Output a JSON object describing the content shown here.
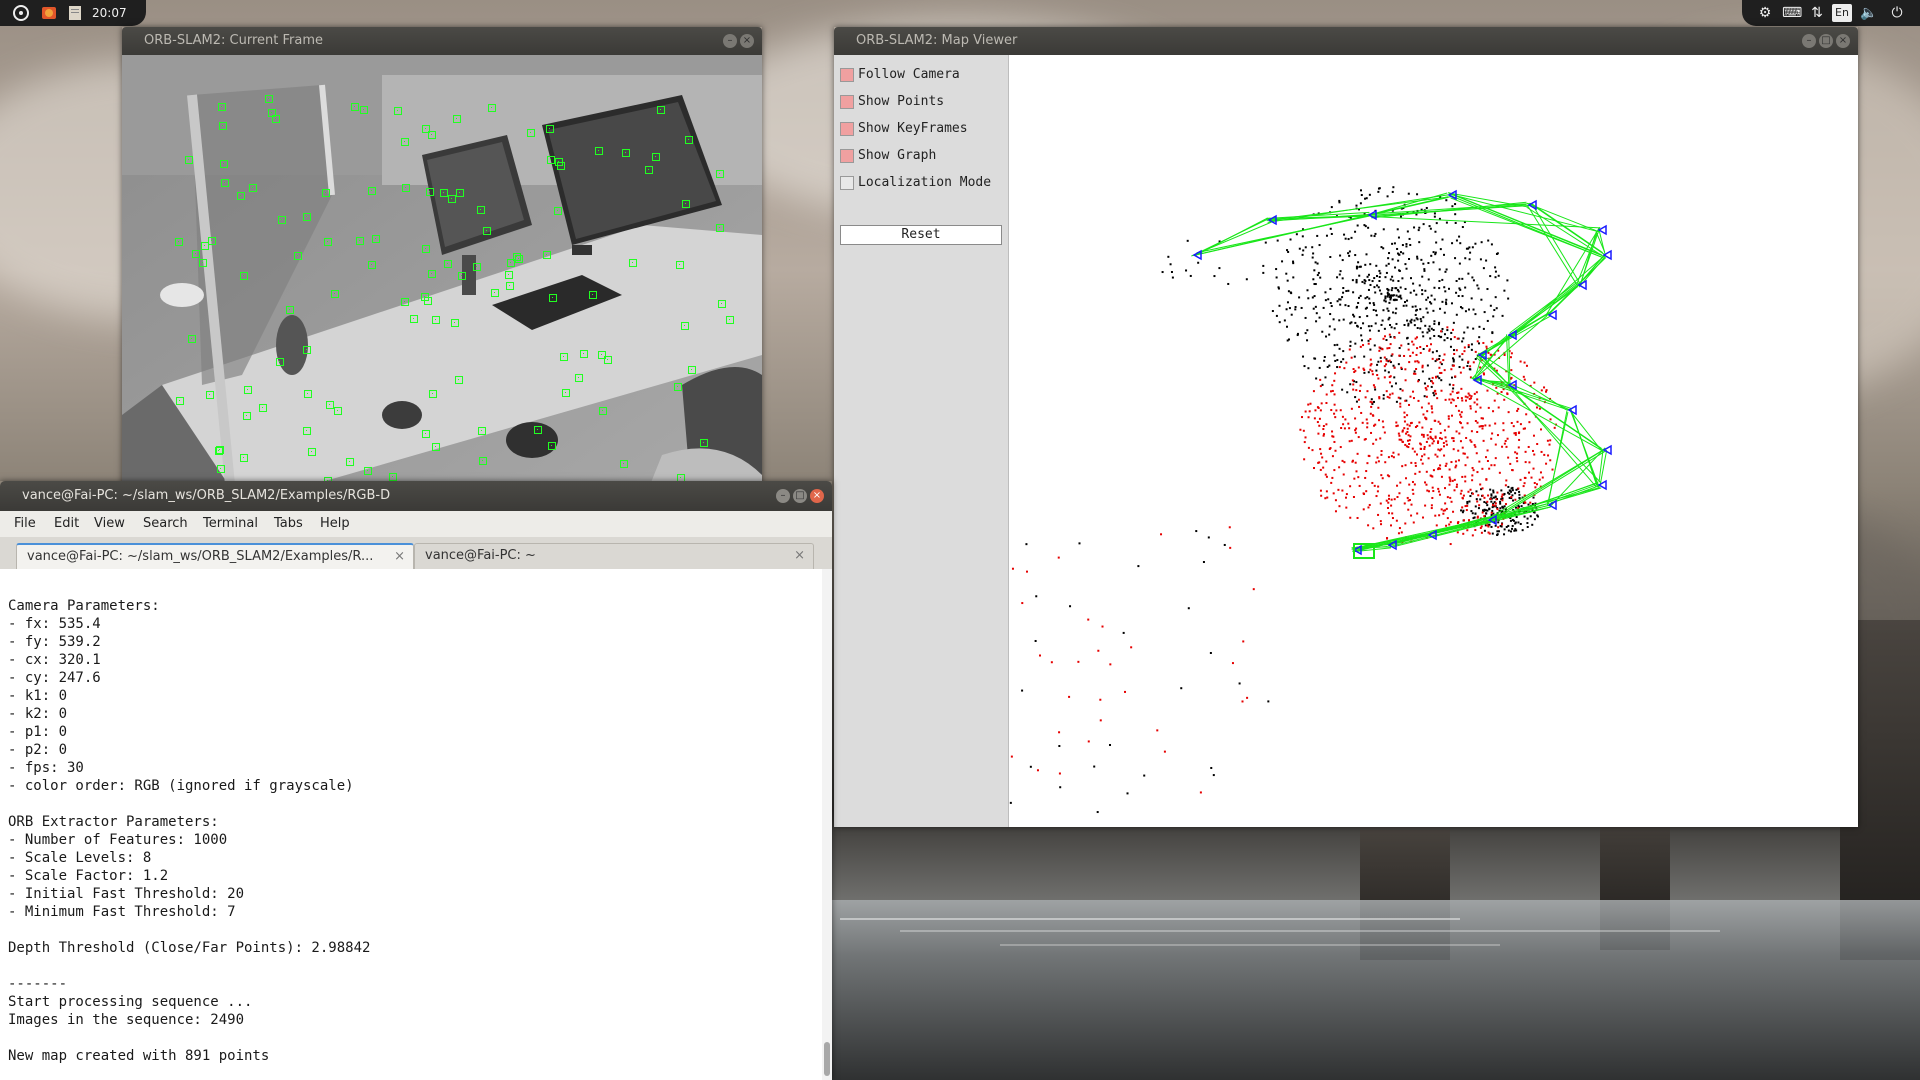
{
  "panel": {
    "clock": "20:07",
    "left_icons": [
      "ubuntu-logo-icon",
      "firefox-icon",
      "files-icon"
    ],
    "right_icons": [
      "settings-icon",
      "keyboard-icon",
      "network-icon",
      "language-icon",
      "volume-icon",
      "power-icon"
    ],
    "language": "En"
  },
  "current_frame": {
    "title": "ORB-SLAM2: Current Frame"
  },
  "map_viewer": {
    "title": "ORB-SLAM2: Map Viewer",
    "options": [
      {
        "label": "Follow Camera",
        "checked": true
      },
      {
        "label": "Show Points",
        "checked": true
      },
      {
        "label": "Show KeyFrames",
        "checked": true
      },
      {
        "label": "Show Graph",
        "checked": true
      },
      {
        "label": "Localization Mode",
        "checked": false
      }
    ],
    "reset_label": "Reset",
    "colors": {
      "keyframe": "#1a1aff",
      "graph": "#19e619",
      "map_point": "#e60000",
      "old_point": "#000000"
    }
  },
  "terminal": {
    "title": "vance@Fai-PC: ~/slam_ws/ORB_SLAM2/Examples/RGB-D",
    "menu": [
      "File",
      "Edit",
      "View",
      "Search",
      "Terminal",
      "Tabs",
      "Help"
    ],
    "tabs": [
      {
        "label": "vance@Fai-PC: ~/slam_ws/ORB_SLAM2/Examples/R...",
        "active": true
      },
      {
        "label": "vance@Fai-PC: ~",
        "active": false
      }
    ],
    "output": "\nCamera Parameters:\n- fx: 535.4\n- fy: 539.2\n- cx: 320.1\n- cy: 247.6\n- k1: 0\n- k2: 0\n- p1: 0\n- p2: 0\n- fps: 30\n- color order: RGB (ignored if grayscale)\n\nORB Extractor Parameters:\n- Number of Features: 1000\n- Scale Levels: 8\n- Scale Factor: 1.2\n- Initial Fast Threshold: 20\n- Minimum Fast Threshold: 7\n\nDepth Threshold (Close/Far Points): 2.98842\n\n-------\nStart processing sequence ...\nImages in the sequence: 2490\n\nNew map created with 891 points"
  }
}
